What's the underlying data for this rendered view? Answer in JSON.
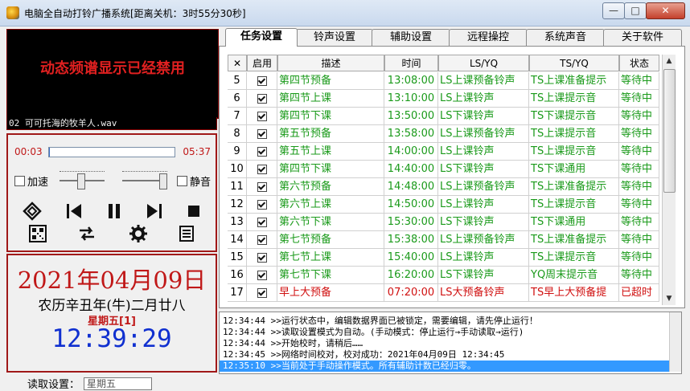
{
  "window": {
    "title": "电脑全自动打铃广播系统[距离关机：3时55分30秒]",
    "minimize": "—",
    "maximize": "□",
    "close": "✕"
  },
  "player": {
    "spectrum_message": "动态频谱显示已经禁用",
    "now_playing": "02 可可托海的牧羊人.wav",
    "time_current": "00:03",
    "time_total": "05:37",
    "progress": 0.009,
    "speedup_label": "加速",
    "mute_label": "静音"
  },
  "datetime": {
    "date": "2021年04月09日",
    "lunar": "农历辛丑年(牛)二月廿八",
    "weekday": "星期五[1]",
    "clock": "12:39:29"
  },
  "tabs": [
    {
      "label": "任务设置",
      "active": true
    },
    {
      "label": "铃声设置",
      "active": false
    },
    {
      "label": "辅助设置",
      "active": false
    },
    {
      "label": "远程操控",
      "active": false
    },
    {
      "label": "系统声音",
      "active": false
    },
    {
      "label": "关于软件",
      "active": false
    }
  ],
  "table": {
    "headers": [
      "✕",
      "启用",
      "描述",
      "时间",
      "LS/YQ",
      "TS/YQ",
      "状态"
    ],
    "rows": [
      {
        "no": "5",
        "enabled": true,
        "desc": "第四节预备",
        "time": "13:08:00",
        "ls": "LS上课预备铃声",
        "ts": "TS上课准备提示",
        "status": "等待中",
        "color": "green"
      },
      {
        "no": "6",
        "enabled": true,
        "desc": "第四节上课",
        "time": "13:10:00",
        "ls": "LS上课铃声",
        "ts": "TS上课提示音",
        "status": "等待中",
        "color": "green"
      },
      {
        "no": "7",
        "enabled": true,
        "desc": "第四节下课",
        "time": "13:50:00",
        "ls": "LS下课铃声",
        "ts": "TS下课提示音",
        "status": "等待中",
        "color": "green"
      },
      {
        "no": "8",
        "enabled": true,
        "desc": "第五节预备",
        "time": "13:58:00",
        "ls": "LS上课预备铃声",
        "ts": "TS上课提示音",
        "status": "等待中",
        "color": "green"
      },
      {
        "no": "9",
        "enabled": true,
        "desc": "第五节上课",
        "time": "14:00:00",
        "ls": "LS上课铃声",
        "ts": "TS上课提示音",
        "status": "等待中",
        "color": "green"
      },
      {
        "no": "10",
        "enabled": true,
        "desc": "第四节下课",
        "time": "14:40:00",
        "ls": "LS下课铃声",
        "ts": "TS下课通用",
        "status": "等待中",
        "color": "green"
      },
      {
        "no": "11",
        "enabled": true,
        "desc": "第六节预备",
        "time": "14:48:00",
        "ls": "LS上课预备铃声",
        "ts": "TS上课准备提示",
        "status": "等待中",
        "color": "green"
      },
      {
        "no": "12",
        "enabled": true,
        "desc": "第六节上课",
        "time": "14:50:00",
        "ls": "LS上课铃声",
        "ts": "TS上课提示音",
        "status": "等待中",
        "color": "green"
      },
      {
        "no": "13",
        "enabled": true,
        "desc": "第六节下课",
        "time": "15:30:00",
        "ls": "LS下课铃声",
        "ts": "TS下课通用",
        "status": "等待中",
        "color": "green"
      },
      {
        "no": "14",
        "enabled": true,
        "desc": "第七节预备",
        "time": "15:38:00",
        "ls": "LS上课预备铃声",
        "ts": "TS上课准备提示",
        "status": "等待中",
        "color": "green"
      },
      {
        "no": "15",
        "enabled": true,
        "desc": "第七节上课",
        "time": "15:40:00",
        "ls": "LS上课铃声",
        "ts": "TS上课提示音",
        "status": "等待中",
        "color": "green"
      },
      {
        "no": "16",
        "enabled": true,
        "desc": "第七节下课",
        "time": "16:20:00",
        "ls": "LS下课铃声",
        "ts": "YQ周末提示音",
        "status": "等待中",
        "color": "green"
      },
      {
        "no": "17",
        "enabled": true,
        "desc": "早上大预备",
        "time": "07:20:00",
        "ls": "LS大预备铃声",
        "ts": "TS早上大预备提",
        "status": "已超时",
        "color": "red"
      }
    ]
  },
  "log": [
    {
      "text": "12:34:44 >>运行状态中，编辑数据界面已被锁定，需要编辑，请先停止运行！",
      "selected": false
    },
    {
      "text": "12:34:44 >>读取设置模式为自动。(手动模式：停止运行→手动读取→运行)",
      "selected": false
    },
    {
      "text": "12:34:44 >>开始校时，请稍后……",
      "selected": false
    },
    {
      "text": "12:34:45 >>网络时间校对，校对成功：2021年04月09日 12:34:45",
      "selected": false
    },
    {
      "text": "12:35:10 >>当前处于手动操作模式。所有辅助计数已经归零。",
      "selected": true
    }
  ],
  "bottom": {
    "read_label": "读取设置：",
    "read_value": "星期五"
  },
  "colors": {
    "accent_red": "#c01818",
    "clock_blue": "#1030d0",
    "row_green": "#1a9a1a",
    "row_red": "#d01010",
    "selection": "#3399ff"
  },
  "icons": [
    "app-icon",
    "stop-loop-icon",
    "prev-icon",
    "pause-icon",
    "next-icon",
    "stop-icon",
    "qr-icon",
    "shuffle-icon",
    "gear-icon",
    "list-icon"
  ]
}
